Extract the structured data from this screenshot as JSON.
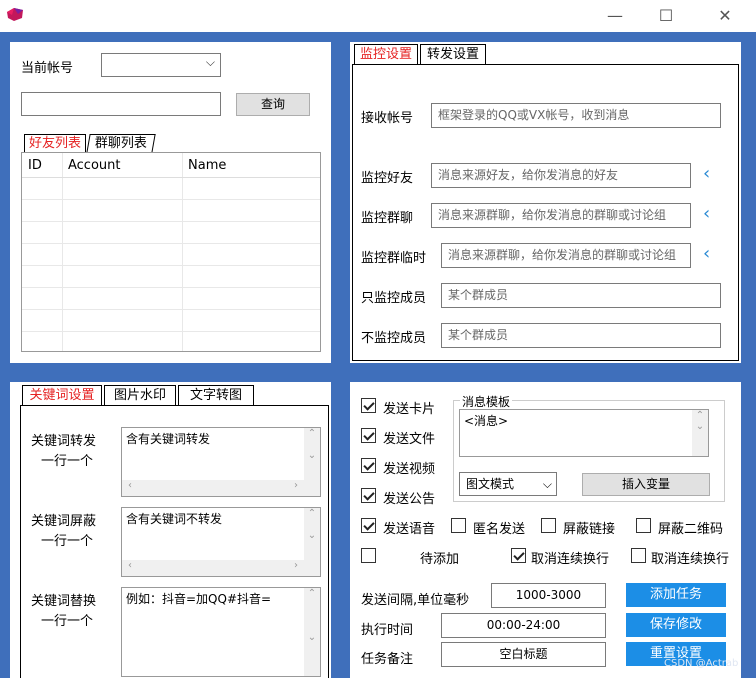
{
  "window": {
    "minimize": "—",
    "maximize": "☐",
    "close": "✕"
  },
  "account": {
    "label": "当前帐号",
    "search_btn": "查询"
  },
  "list_tabs": [
    "好友列表",
    "群聊列表"
  ],
  "grid": {
    "headers": [
      "ID",
      "Account",
      "Name"
    ]
  },
  "monitor_tabs": [
    "监控设置",
    "转发设置"
  ],
  "monitor": {
    "receive_label": "接收帐号",
    "receive_placeholder": "框架登录的QQ或VX帐号，收到消息",
    "friend_label": "监控好友",
    "friend_placeholder": "消息来源好友，给你发消息的好友",
    "group_label": "监控群聊",
    "group_placeholder": "消息来源群聊，给你发消息的群聊或讨论组",
    "temp_label": "监控群临时",
    "temp_placeholder": "消息来源群聊，给你发消息的群聊或讨论组",
    "only_label": "只监控成员",
    "only_placeholder": "某个群成员",
    "exclude_label": "不监控成员",
    "exclude_placeholder": "某个群成员"
  },
  "kw_tabs": [
    "关键词设置",
    "图片水印",
    "文字转图"
  ],
  "keywords": {
    "forward_label1": "关键词转发",
    "forward_label2": "一行一个",
    "forward_value": "含有关键词转发",
    "block_label1": "关键词屏蔽",
    "block_label2": "一行一个",
    "block_value": "含有关键词不转发",
    "replace_label1": "关键词替换",
    "replace_label2": "一行一个",
    "replace_value": "例如：抖音=加QQ#抖音="
  },
  "send": {
    "card": "发送卡片",
    "file": "发送文件",
    "video": "发送视频",
    "notice": "发送公告",
    "template_label": "消息模板",
    "template_value": "<消息>",
    "mode_value": "图文模式",
    "insert_var": "插入变量",
    "voice": "发送语音",
    "anonymous": "匿名发送",
    "block_link": "屏蔽链接",
    "block_qr": "屏蔽二维码",
    "to_add": "待添加",
    "cancel_newline1": "取消连续换行",
    "cancel_newline2": "取消连续换行",
    "interval_label": "发送间隔,单位毫秒",
    "interval_value": "1000-3000",
    "exec_label": "执行时间",
    "exec_value": "00:00-24:00",
    "note_label": "任务备注",
    "note_value": "空白标题",
    "add_task": "添加任务",
    "save": "保存修改",
    "reset": "重置设置"
  },
  "watermark": "CSDN @Actrab",
  "colors": {
    "accent": "#1c8ee6",
    "active_tab": "#e52222",
    "window_bg": "#3f6fbb"
  }
}
